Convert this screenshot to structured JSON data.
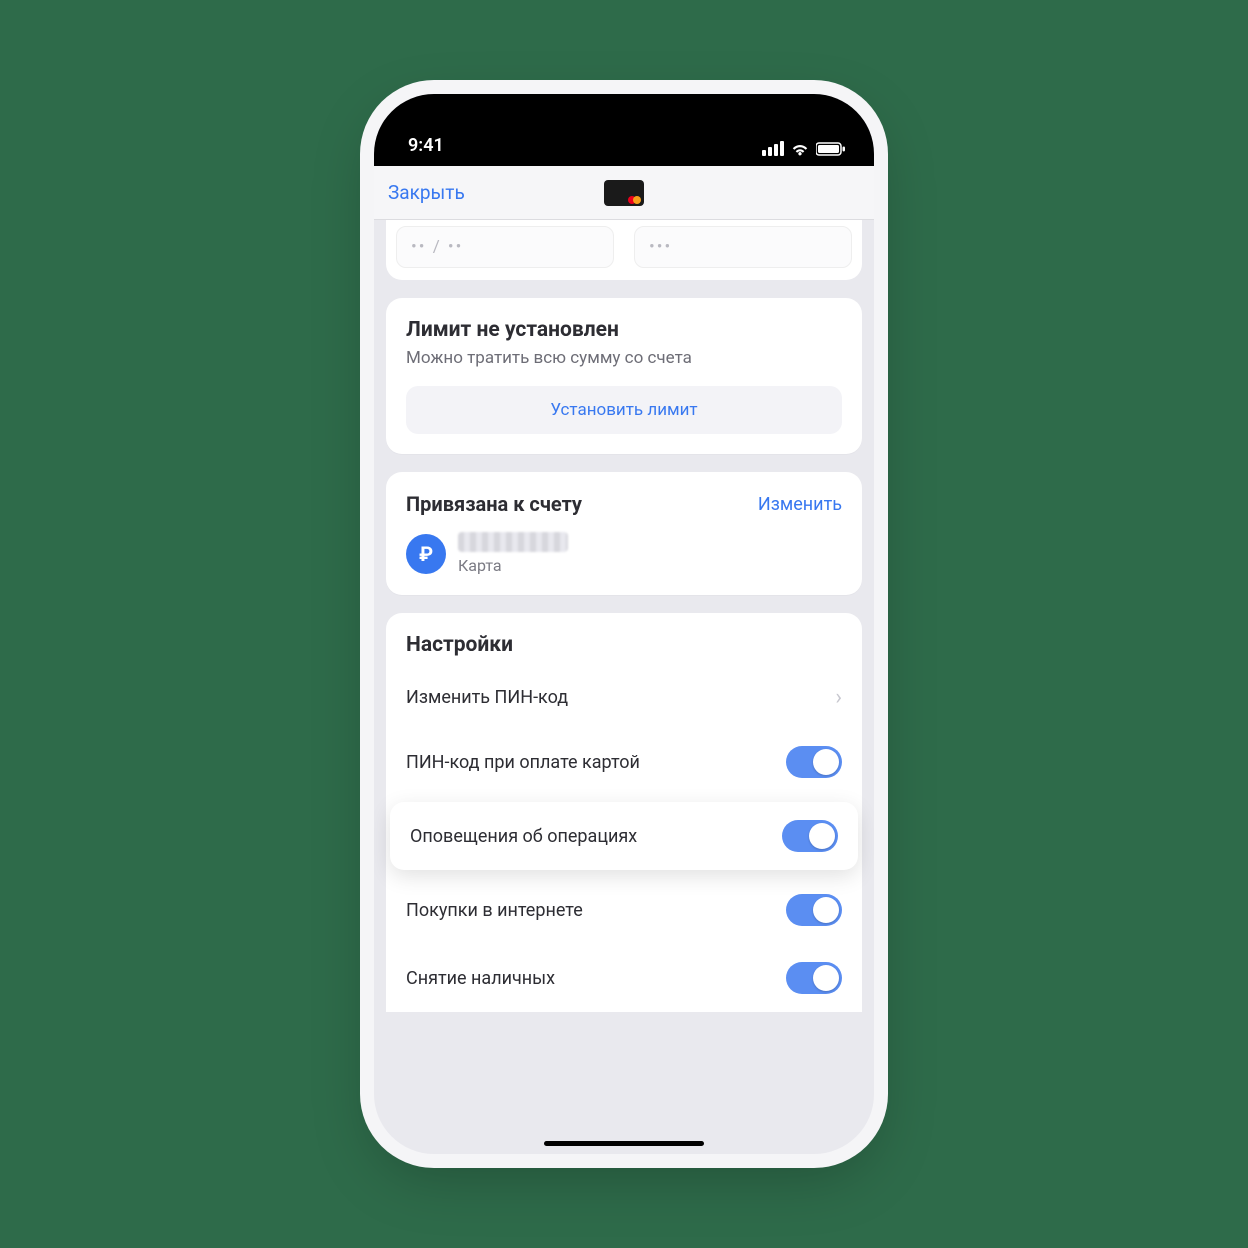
{
  "status": {
    "time": "9:41"
  },
  "nav": {
    "close": "Закрыть"
  },
  "secret": {
    "expiry": "•• / ••",
    "cvv": "•••"
  },
  "limit": {
    "title": "Лимит не установлен",
    "subtitle": "Можно тратить всю сумму со счета",
    "button": "Установить лимит"
  },
  "linked": {
    "title": "Привязана к счету",
    "change": "Изменить",
    "badge": "₽",
    "label": "Карта"
  },
  "settings": {
    "title": "Настройки",
    "rows": {
      "change_pin": "Изменить ПИН-код",
      "pin_on_pay": "ПИН-код при оплате картой",
      "notifications": "Оповещения об операциях",
      "online": "Покупки в интернете",
      "cash": "Снятие наличных"
    }
  }
}
